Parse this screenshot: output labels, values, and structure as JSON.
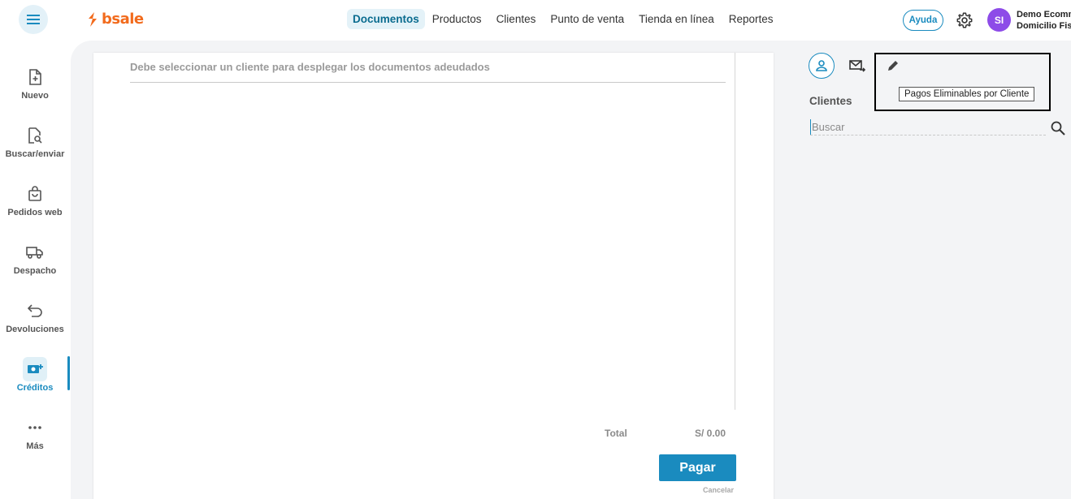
{
  "app": {
    "logo_text": "bsale",
    "brand_color": "#f26b1d",
    "accent": "#1a8bbf"
  },
  "topnav": {
    "items": [
      {
        "label": "Documentos",
        "active": true
      },
      {
        "label": "Productos"
      },
      {
        "label": "Clientes"
      },
      {
        "label": "Punto de venta"
      },
      {
        "label": "Tienda en línea"
      },
      {
        "label": "Reportes"
      }
    ],
    "help_label": "Ayuda",
    "avatar_initials": "SI",
    "user_line1": "Demo Ecomm",
    "user_line2": "Domicilio Fis"
  },
  "sidebar": {
    "items": [
      {
        "label": "Nuevo",
        "icon": "file-plus-icon"
      },
      {
        "label": "Buscar/enviar",
        "icon": "file-search-icon"
      },
      {
        "label": "Pedidos web",
        "icon": "shopping-bag-icon"
      },
      {
        "label": "Despacho",
        "icon": "truck-icon"
      },
      {
        "label": "Devoluciones",
        "icon": "return-arrow-icon"
      },
      {
        "label": "Créditos",
        "icon": "credit-money-icon",
        "active": true
      },
      {
        "label": "Más",
        "icon": "more-dots-icon"
      }
    ]
  },
  "main": {
    "notice": "Debe seleccionar un cliente para desplegar los documentos adeudados",
    "total_label": "Total",
    "total_value": "S/ 0.00",
    "pay_button": "Pagar",
    "cancel_link": "Cancelar"
  },
  "right_panel": {
    "tooltip": "Pagos Eliminables por Cliente",
    "section_title": "Clientes",
    "search_placeholder": "Buscar"
  }
}
